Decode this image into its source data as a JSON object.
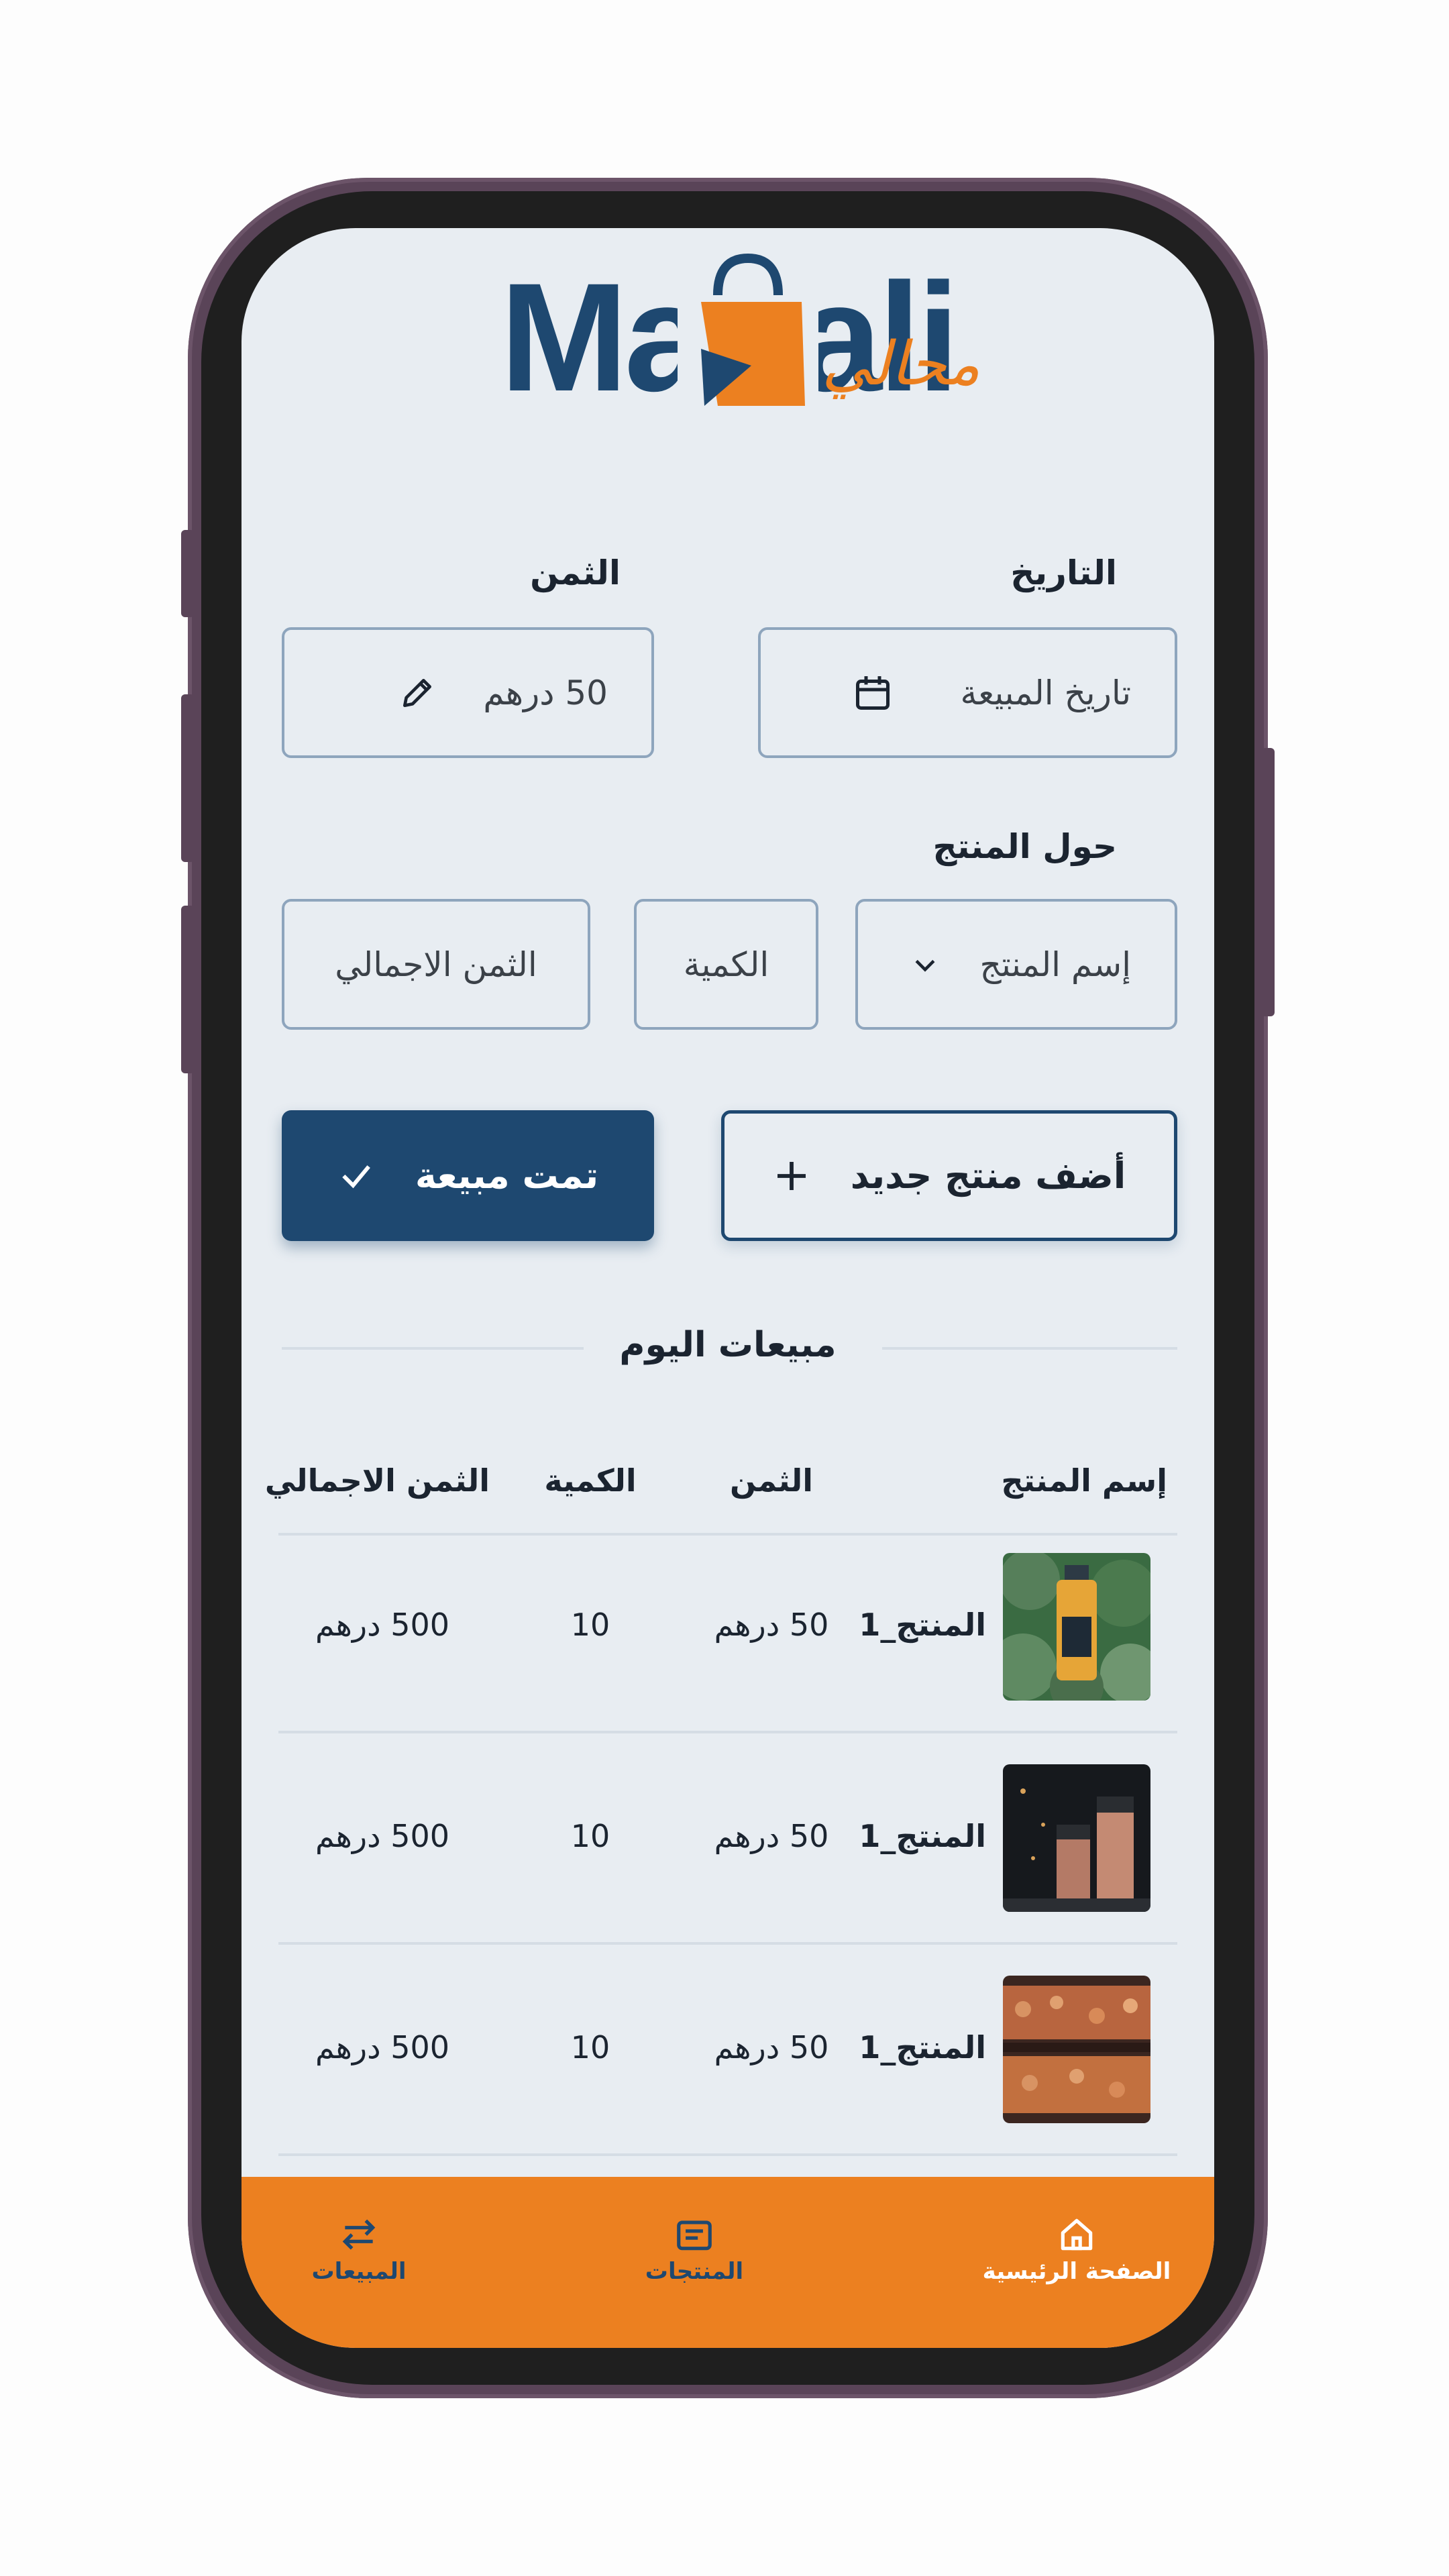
{
  "app": {
    "logo_latin": "Mahali",
    "logo_arabic": "محالي"
  },
  "form": {
    "date_label": "التاريخ",
    "date_placeholder": "تاريخ المبيعة",
    "price_label": "الثمن",
    "price_value": "50 درهم",
    "product_section_label": "حول المنتج",
    "product_name_placeholder": "إسم المنتج",
    "quantity_placeholder": "الكمية",
    "total_price_placeholder": "الثمن الاجمالي"
  },
  "actions": {
    "add_product_label": "أضف منتج جديد",
    "sale_done_label": "تمت مبيعة"
  },
  "today_sales": {
    "title": "مبيعات اليوم",
    "columns": [
      "إسم المنتج",
      "الثمن",
      "الكمية",
      "الثمن الاجمالي"
    ],
    "rows": [
      {
        "name": "المنتج_1",
        "price": "50 درهم",
        "quantity": "10",
        "total": "500 درهم",
        "image": "juice-bottle"
      },
      {
        "name": "المنتج_1",
        "price": "50 درهم",
        "quantity": "10",
        "total": "500 درهم",
        "image": "dark-bottles"
      },
      {
        "name": "المنتج_1",
        "price": "50 درهم",
        "quantity": "10",
        "total": "500 درهم",
        "image": "nuts-jars"
      }
    ]
  },
  "nav": {
    "items": [
      {
        "label": "الصفحة الرئيسية",
        "icon": "home-icon"
      },
      {
        "label": "المنتجات",
        "icon": "products-icon"
      },
      {
        "label": "المبيعات",
        "icon": "swap-arrows-icon"
      }
    ]
  },
  "colors": {
    "primary": "#1e4870",
    "accent": "#ec8020",
    "background": "#e8edf2",
    "frame": "#5a4458"
  }
}
